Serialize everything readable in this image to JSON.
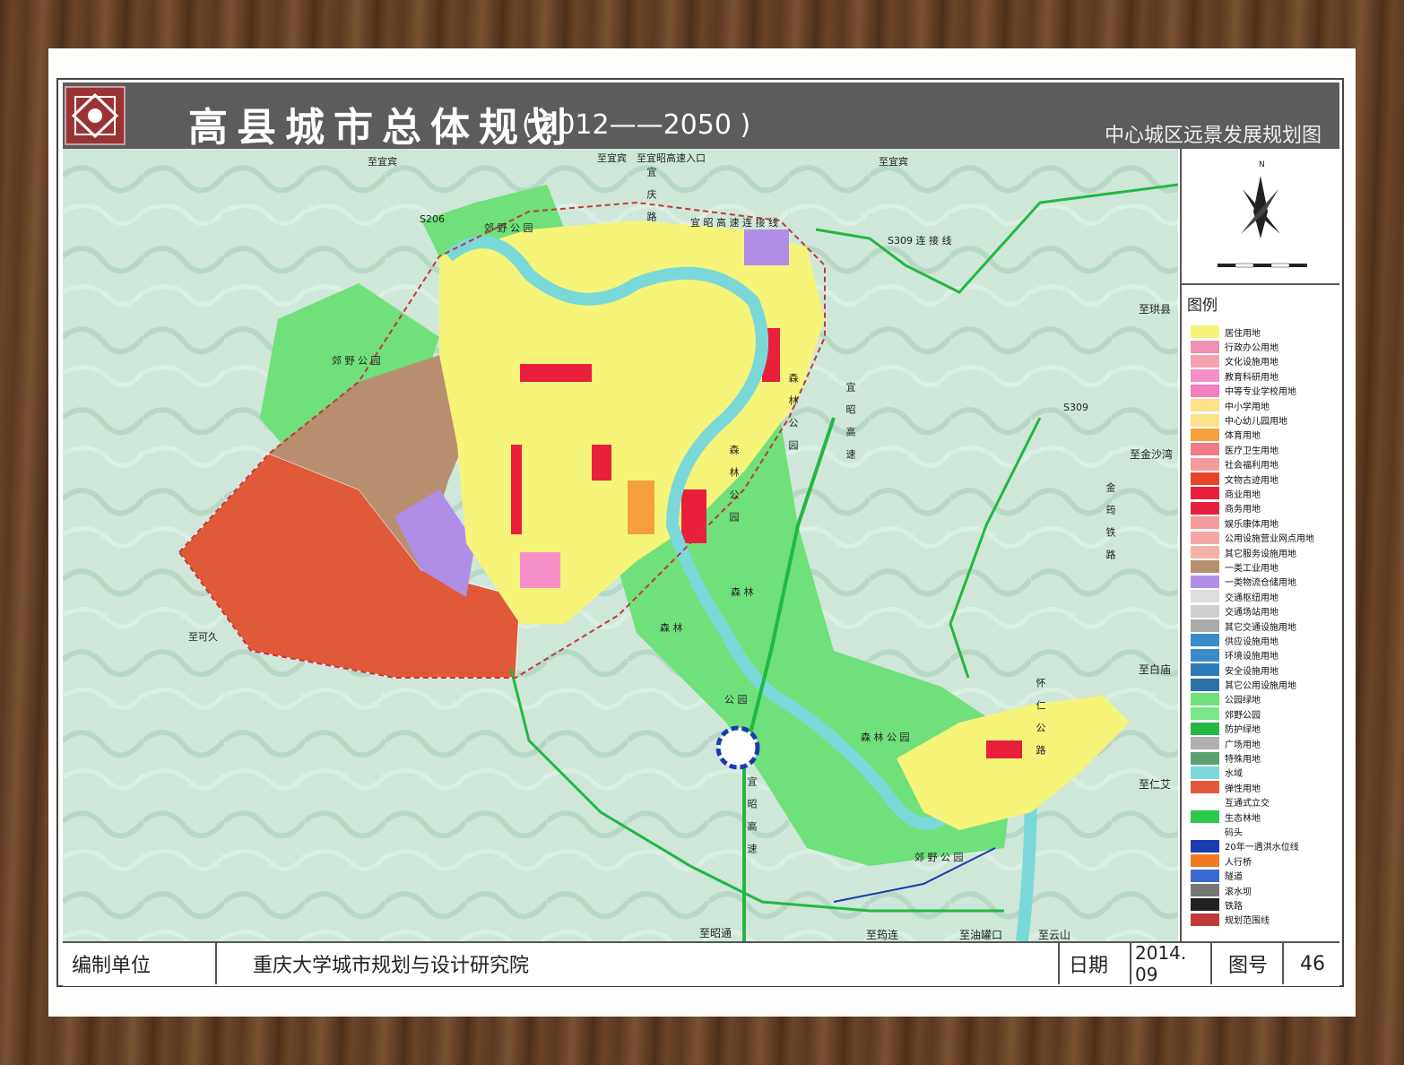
{
  "header": {
    "title": "高县城市总体规划",
    "years": "( 2012——2050 )",
    "subtitle": "中心城区远景发展规划图"
  },
  "map_labels": {
    "to_yibin_1": "至宜宾",
    "to_yibin_2": "至宜宾",
    "to_yibin_expressway": "至宜宾　至宜昭高速入口",
    "s206": "S206",
    "suburban_park_top": "郊 野 公 园",
    "suburban_park_left": "郊 野 公 园",
    "suburban_park_bottom": "郊 野 公 园",
    "yizhao_link": "宜 昭 高 速 连 接 线",
    "s309_link": "S309 连 接 线",
    "qing_road": "宜庆路",
    "to_gongxian": "至珙县",
    "s309": "S309",
    "to_jinshawan": "至金沙湾",
    "jinyun_railway": "金筠铁路",
    "yizhao_expressway": "宜昭高速",
    "forest_park_1": "森林公园",
    "forest_park_2": "森林公园",
    "forest_park_3": "森 林 公 园",
    "forest_1": "森 林",
    "forest_2": "森 林",
    "park": "公 园",
    "to_kejiu": "至可久",
    "to_baimiao": "至白庙",
    "huairen_road": "怀仁公路",
    "to_renyi": "至仁艾",
    "yizhao_expressway_2": "宜昭高速",
    "to_zhaotong": "至昭通",
    "to_junlian": "至筠连",
    "to_youguankou": "至油罐口",
    "to_yunshan": "至云山"
  },
  "legend": {
    "title": "图例",
    "items": [
      {
        "label": "居住用地",
        "color": "#f7f47a"
      },
      {
        "label": "行政办公用地",
        "color": "#f28fb5"
      },
      {
        "label": "文化设施用地",
        "color": "#f4a2b0"
      },
      {
        "label": "教育科研用地",
        "color": "#f58fc8"
      },
      {
        "label": "中等专业学校用地",
        "color": "#f07ec0"
      },
      {
        "label": "中小学用地",
        "color": "#fce08a"
      },
      {
        "label": "中心幼儿园用地",
        "color": "#fce08a"
      },
      {
        "label": "体育用地",
        "color": "#f5a03a"
      },
      {
        "label": "医疗卫生用地",
        "color": "#f07a8a"
      },
      {
        "label": "社会福利用地",
        "color": "#f49a9a"
      },
      {
        "label": "文物古迹用地",
        "color": "#e8442c"
      },
      {
        "label": "商业用地",
        "color": "#e8203c"
      },
      {
        "label": "商务用地",
        "color": "#e8203c"
      },
      {
        "label": "娱乐康体用地",
        "color": "#f39a9a"
      },
      {
        "label": "公用设施营业网点用地",
        "color": "#f4a6a6"
      },
      {
        "label": "其它服务设施用地",
        "color": "#f6b2a6"
      },
      {
        "label": "一类工业用地",
        "color": "#b89070"
      },
      {
        "label": "一类物流仓储用地",
        "color": "#b08ee8"
      },
      {
        "label": "交通枢纽用地",
        "color": "#dddddd"
      },
      {
        "label": "交通场站用地",
        "color": "#cfcfcf"
      },
      {
        "label": "其它交通设施用地",
        "color": "#aaaaaa"
      },
      {
        "label": "供应设施用地",
        "color": "#3a8ac8"
      },
      {
        "label": "环境设施用地",
        "color": "#3a8ac8"
      },
      {
        "label": "安全设施用地",
        "color": "#2c7ab8"
      },
      {
        "label": "其它公用设施用地",
        "color": "#2c70aa"
      },
      {
        "label": "公园绿地",
        "color": "#6fe07a"
      },
      {
        "label": "郊野公园",
        "color": "#78e88a"
      },
      {
        "label": "防护绿地",
        "color": "#22b844"
      },
      {
        "label": "广场用地",
        "color": "#b0b0b0"
      },
      {
        "label": "特殊用地",
        "color": "#5aa070"
      },
      {
        "label": "水域",
        "color": "#7ad8d8"
      },
      {
        "label": "弹性用地",
        "color": "#e05a3a"
      },
      {
        "label": "互通式立交",
        "color": "#ffffff"
      },
      {
        "label": "生态林地",
        "color": "#2cc84a"
      },
      {
        "label": "码头",
        "color": "#ffffff"
      },
      {
        "label": "20年一遇洪水位线",
        "color": "#1a3ab0"
      },
      {
        "label": "人行桥",
        "color": "#f07a20"
      },
      {
        "label": "隧道",
        "color": "#3a6ad0"
      },
      {
        "label": "滚水坝",
        "color": "#777777"
      },
      {
        "label": "铁路",
        "color": "#222222"
      },
      {
        "label": "规划范围线",
        "color": "#c03a3a"
      }
    ]
  },
  "footer": {
    "compiler_label": "编制单位",
    "compiler": "重庆大学城市规划与设计研究院",
    "date_label": "日期",
    "date": "2014. 09",
    "figure_label": "图号",
    "figure_no": "46"
  },
  "colors": {
    "residential": "#f7f47a",
    "commercial": "#e8203c",
    "industrial": "#b89070",
    "logistics": "#b08ee8",
    "flexible": "#e05a3a",
    "green": "#6fe07a",
    "water": "#7ad8d8",
    "terrain": "#cfe7d9"
  }
}
